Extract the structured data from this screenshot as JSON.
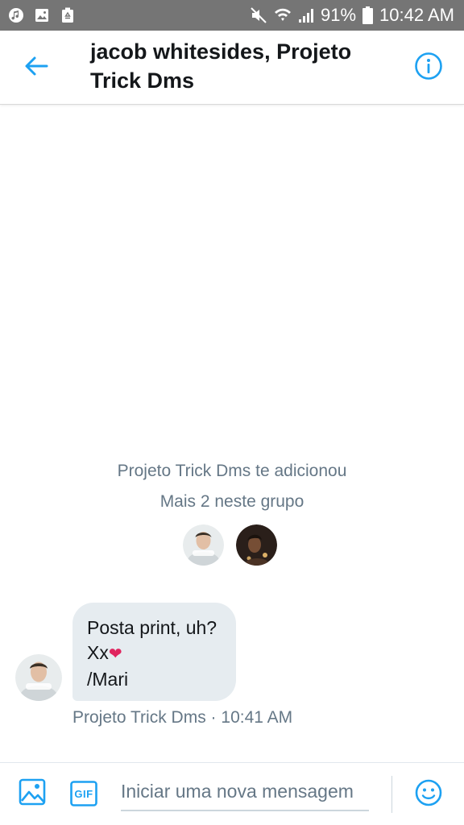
{
  "status_bar": {
    "battery": "91%",
    "time": "10:42 AM",
    "icons_left": [
      "music-icon",
      "image-icon",
      "recycle-icon"
    ],
    "icons_right": [
      "mute-icon",
      "wifi-icon",
      "signal-icon",
      "battery-icon"
    ]
  },
  "header": {
    "title_line1": "jacob whitesides, Projeto",
    "title_line2": "Trick Dms",
    "back_icon": "back-arrow-icon",
    "info_icon": "info-icon"
  },
  "conversation": {
    "system_added": "Projeto Trick Dms te adicionou",
    "system_more": "Mais 2 neste grupo",
    "message": {
      "line1": "Posta print, uh?",
      "line2": "Xx",
      "heart": "❤",
      "line3": "/Mari",
      "sender": "Projeto Trick Dms",
      "separator": "·",
      "time": "10:41 AM"
    }
  },
  "composer": {
    "placeholder": "Iniciar uma nova mensagem",
    "gif_label": "GIF",
    "image_icon": "image-icon",
    "emoji_icon": "emoji-icon"
  },
  "colors": {
    "accent": "#1da1f2",
    "status_bar": "#757575",
    "bubble": "#e6ecf0",
    "secondary_text": "#657786",
    "heart": "#e0245e"
  }
}
